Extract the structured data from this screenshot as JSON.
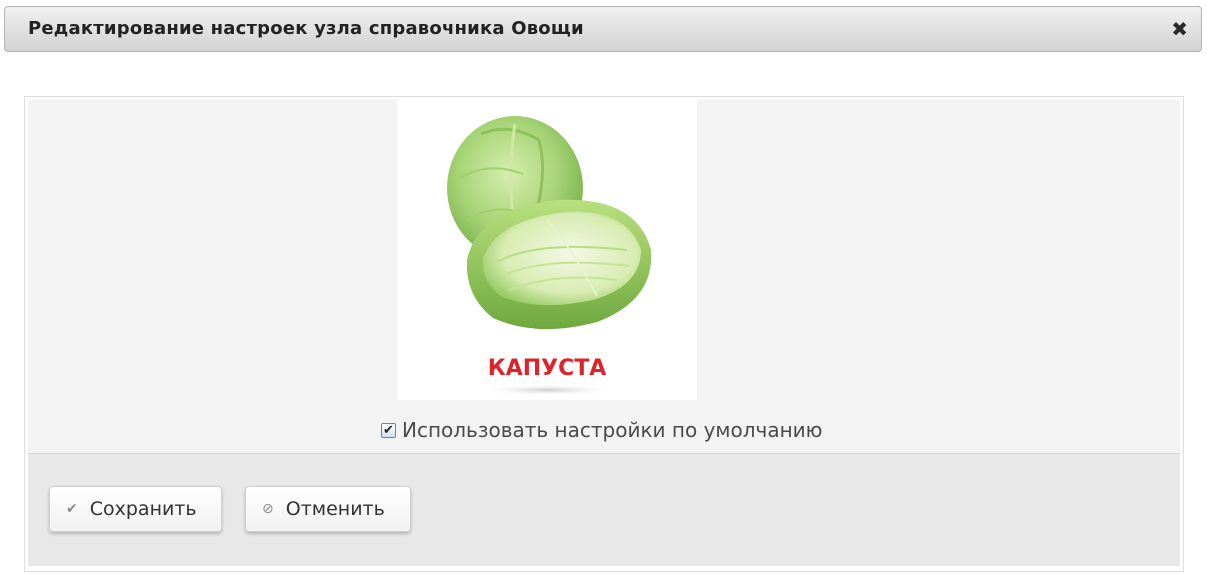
{
  "dialog": {
    "title": "Редактирование настроек узла справочника Овощи",
    "close_icon": "close-icon"
  },
  "image": {
    "caption": "КАПУСТА",
    "caption_color": "#e0232a"
  },
  "settings": {
    "use_defaults_label": "Использовать настройки по умолчанию",
    "use_defaults_checked": true
  },
  "footer": {
    "save_label": "Сохранить",
    "save_icon": "checkmark-icon",
    "cancel_label": "Отменить",
    "cancel_icon": "cancel-icon"
  }
}
